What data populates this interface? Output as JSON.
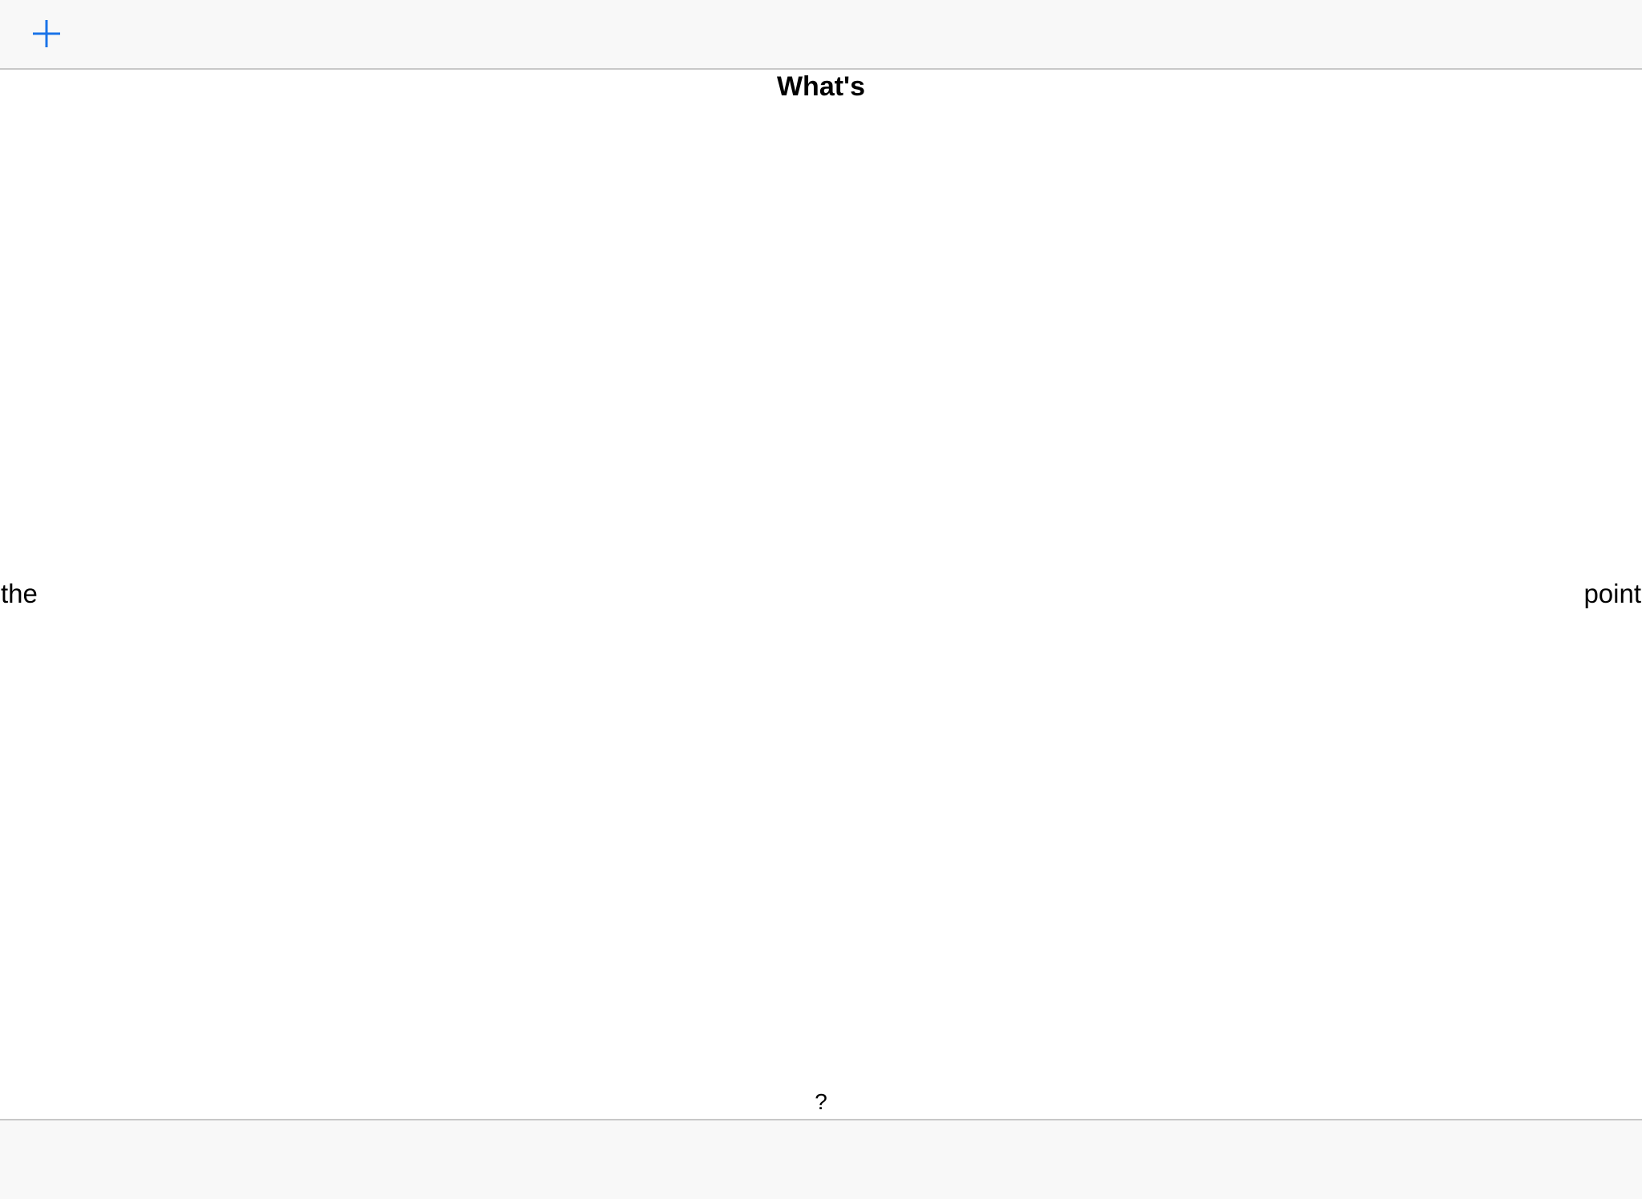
{
  "toolbar": {
    "add_icon": "plus-icon",
    "accent_color": "#1a73e8"
  },
  "content": {
    "top_word": "What's",
    "left_word": "the",
    "right_word": "point",
    "bottom_word": "?"
  }
}
